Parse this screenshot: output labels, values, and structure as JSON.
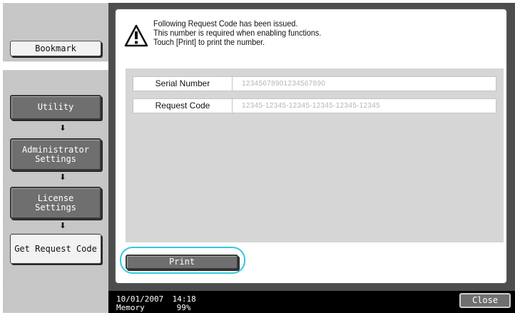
{
  "sidebar": {
    "bookmark_label": "Bookmark",
    "steps": [
      {
        "label": "Utility"
      },
      {
        "label": "Administrator\nSettings"
      },
      {
        "label": "License\nSettings"
      },
      {
        "label": "Get Request Code"
      }
    ],
    "arrow_glyph": "⬇"
  },
  "message": {
    "line1": "Following Request Code has been issued.",
    "line2": "This number is required when enabling functions.",
    "line3": "Touch [Print] to print the number."
  },
  "info": {
    "serial_label": "Serial Number",
    "serial_value": "12345678901234567890",
    "request_label": "Request Code",
    "request_value": "12345-12345-12345-12345-12345-12345"
  },
  "print_label": "Print",
  "status": {
    "date": "10/01/2007",
    "time": "14:18",
    "memory_label": "Memory",
    "memory_value": "99%"
  },
  "close_label": "Close",
  "colors": {
    "highlight": "#33c8e0",
    "button_dark": "#6f6f6f",
    "status_bar": "#000000"
  }
}
